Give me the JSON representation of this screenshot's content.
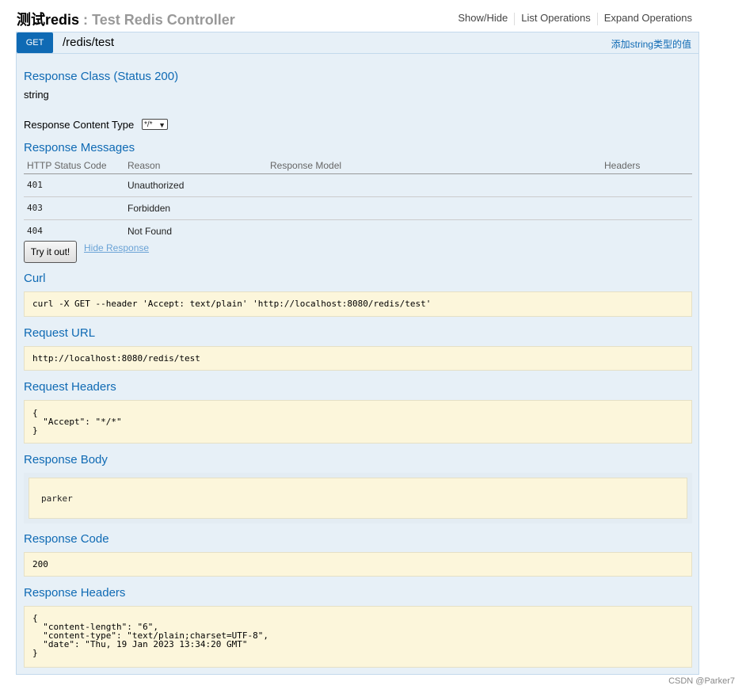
{
  "header": {
    "resource_name": "测试redis",
    "separator": ":",
    "resource_desc": "Test Redis Controller",
    "links": [
      "Show/Hide",
      "List Operations",
      "Expand Operations"
    ]
  },
  "operation": {
    "method": "GET",
    "path": "/redis/test",
    "summary": "添加string类型的值"
  },
  "response_class": {
    "heading": "Response Class (Status 200)",
    "type": "string"
  },
  "content_type": {
    "label": "Response Content Type",
    "selected": "*/*"
  },
  "response_messages": {
    "heading": "Response Messages",
    "columns": [
      "HTTP Status Code",
      "Reason",
      "Response Model",
      "Headers"
    ],
    "rows": [
      {
        "code": "401",
        "reason": "Unauthorized"
      },
      {
        "code": "403",
        "reason": "Forbidden"
      },
      {
        "code": "404",
        "reason": "Not Found"
      }
    ]
  },
  "actions": {
    "try_button": "Try it out!",
    "hide_response": "Hide Response"
  },
  "curl": {
    "heading": "Curl",
    "command": "curl -X GET --header 'Accept: text/plain' 'http://localhost:8080/redis/test'"
  },
  "request_url": {
    "heading": "Request URL",
    "value": "http://localhost:8080/redis/test"
  },
  "request_headers": {
    "heading": "Request Headers",
    "value": "{\n  \"Accept\": \"*/*\"\n}"
  },
  "response_body": {
    "heading": "Response Body",
    "value": "parker"
  },
  "response_code": {
    "heading": "Response Code",
    "value": "200"
  },
  "response_headers": {
    "heading": "Response Headers",
    "value": "{\n  \"content-length\": \"6\",\n  \"content-type\": \"text/plain;charset=UTF-8\",\n  \"date\": \"Thu, 19 Jan 2023 13:34:20 GMT\"\n}"
  },
  "watermark": "CSDN @Parker7",
  "colors": {
    "accent": "#0f6ab4",
    "panel_bg": "#e7f0f7",
    "panel_border": "#c3d9ec",
    "code_bg": "#fcf6db"
  }
}
